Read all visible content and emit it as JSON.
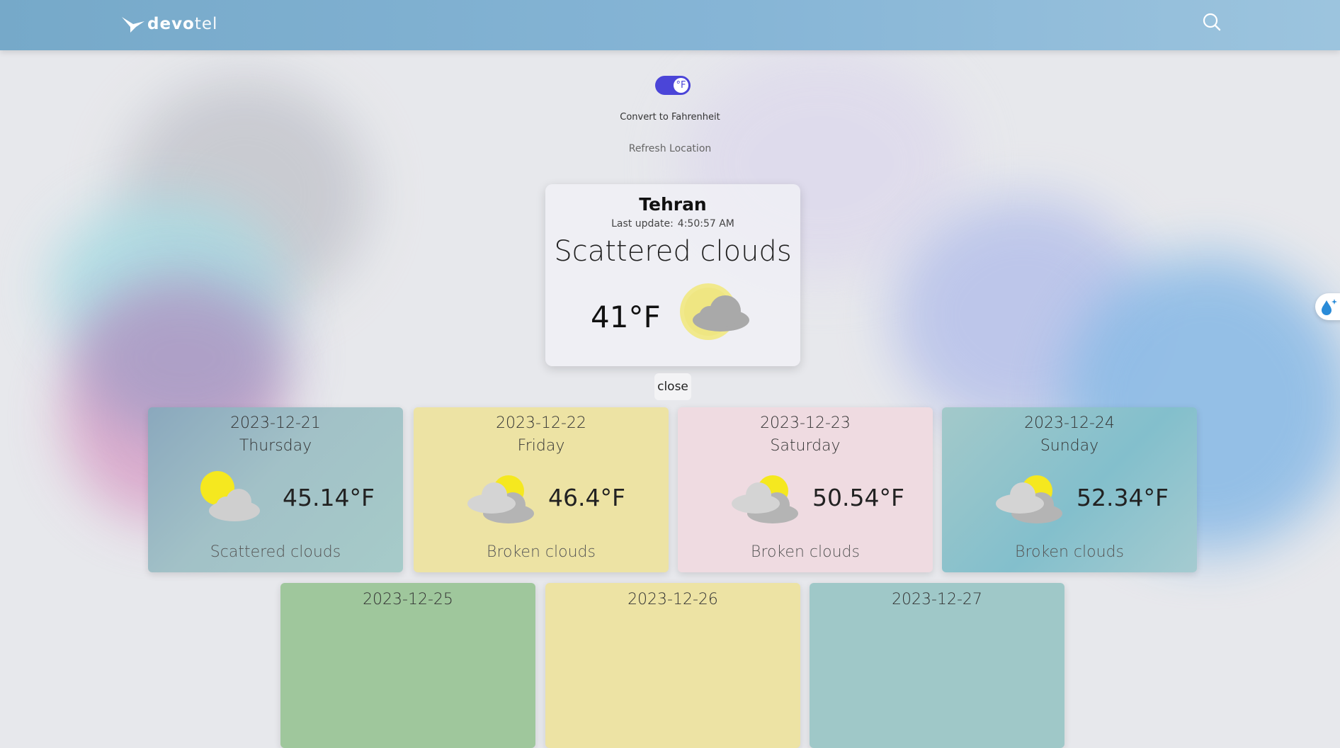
{
  "header": {
    "logo_bold": "devo",
    "logo_light": "tel",
    "search_icon": "search-icon"
  },
  "controls": {
    "toggle_symbol": "°F",
    "toggle_label": "Convert to Fahrenheit",
    "toggle_state": "on",
    "refresh_label": "Refresh Location"
  },
  "current": {
    "city": "Tehran",
    "last_update_label": "Last update:",
    "last_update_time": "4:50:57 AM",
    "condition": "Scattered clouds",
    "temperature": "41°F",
    "icon": "sun-cloud-icon"
  },
  "close_label": "close",
  "forecast": [
    {
      "date": "2023-12-21",
      "day": "Thursday",
      "temp": "45.14°F",
      "desc": "Scattered clouds",
      "icon": "sun-cloud-icon"
    },
    {
      "date": "2023-12-22",
      "day": "Friday",
      "temp": "46.4°F",
      "desc": "Broken clouds",
      "icon": "broken-clouds-icon"
    },
    {
      "date": "2023-12-23",
      "day": "Saturday",
      "temp": "50.54°F",
      "desc": "Broken clouds",
      "icon": "broken-clouds-icon"
    },
    {
      "date": "2023-12-24",
      "day": "Sunday",
      "temp": "52.34°F",
      "desc": "Broken clouds",
      "icon": "broken-clouds-icon"
    },
    {
      "date": "2023-12-25"
    },
    {
      "date": "2023-12-26"
    },
    {
      "date": "2023-12-27"
    }
  ],
  "colors": {
    "accent": "#4b45d8",
    "header": "#86b5d6",
    "card_teal": "#9fc8c8",
    "card_yellow": "#ede3a4",
    "card_pink": "#efdbe1",
    "card_green": "#9fc79c"
  },
  "side_button_icon": "water-drops-icon"
}
